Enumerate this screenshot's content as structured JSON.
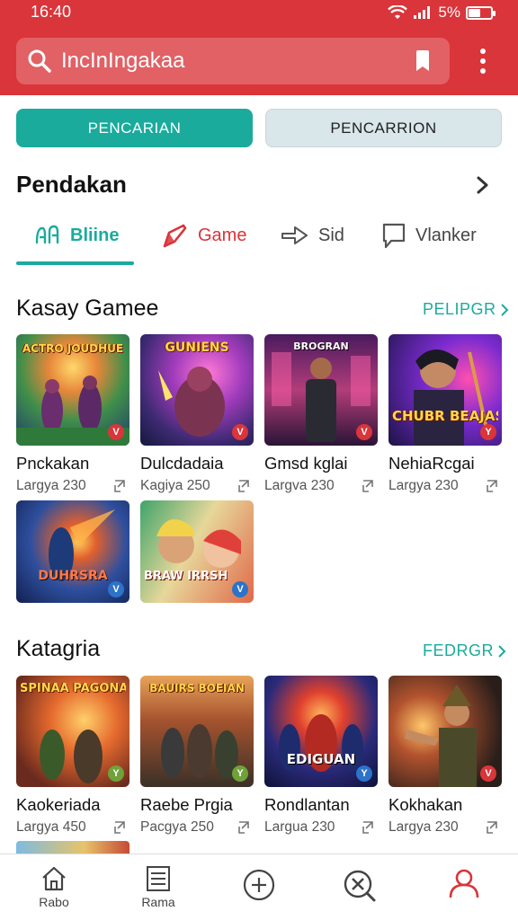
{
  "status": {
    "time": "16:40",
    "battery": "5%",
    "battery_level": 0.55
  },
  "search": {
    "value": "IncInIngakaa"
  },
  "segments": [
    {
      "label": "PENCARIAN"
    },
    {
      "label": "PENCARRION"
    }
  ],
  "section_main": {
    "title": "Pendakan"
  },
  "categories": [
    {
      "label": "Bliine",
      "icon": "analytics-icon",
      "color": "#1aab9d"
    },
    {
      "label": "Game",
      "icon": "pen-icon",
      "color": "#d9353a"
    },
    {
      "label": "Sid",
      "icon": "share-arrow-icon",
      "color": "#555555"
    },
    {
      "label": "Vlanker",
      "icon": "chat-bubble-icon",
      "color": "#555555"
    }
  ],
  "section_games": {
    "title": "Kasay Gamee",
    "see_all": "PELIPGR",
    "cards": [
      {
        "title": "Pnckakan",
        "sub": "Largya 230",
        "art": "ACTRO JOUDHUE",
        "badge": "V"
      },
      {
        "title": "Dulcdadaia",
        "sub": "Kagiya 250",
        "art": "GUNIENS",
        "badge": "V"
      },
      {
        "title": "Gmsd kglai",
        "sub": "Largva 230",
        "art": "BROGRAN",
        "badge": "V"
      },
      {
        "title": "NehiaRcgai",
        "sub": "Largya 230",
        "art": "CHUBR BEAJAS",
        "badge": "Y"
      },
      {
        "title": "",
        "sub": "",
        "art": "DUHRSRA",
        "badge": "V"
      },
      {
        "title": "",
        "sub": "",
        "art": "BRAW IRRSH",
        "badge": "V"
      }
    ]
  },
  "section_category": {
    "title": "Katagria",
    "see_all": "FEDRGR",
    "cards": [
      {
        "title": "Kaokeriada",
        "sub": "Largya 450",
        "art": "SPINAA PAGONAF",
        "badge": "Y"
      },
      {
        "title": "Raebe Prgia",
        "sub": "Pacgya 250",
        "art": "BAUIRS BOEIAN",
        "badge": "Y"
      },
      {
        "title": "Rondlantan",
        "sub": "Largua 230",
        "art": "EDIGUAN",
        "badge": "Y"
      },
      {
        "title": "Kokhakan",
        "sub": "Largya 230",
        "art": "",
        "badge": "V"
      }
    ]
  },
  "bottom_nav": [
    {
      "label": "Rabo",
      "icon": "home-icon"
    },
    {
      "label": "Rama",
      "icon": "list-icon"
    },
    {
      "label": "",
      "icon": "add-circle-icon"
    },
    {
      "label": "",
      "icon": "search-close-icon"
    },
    {
      "label": "",
      "icon": "profile-icon"
    }
  ],
  "colors": {
    "brand_red": "#d9353a",
    "accent_teal": "#1aab9d"
  }
}
